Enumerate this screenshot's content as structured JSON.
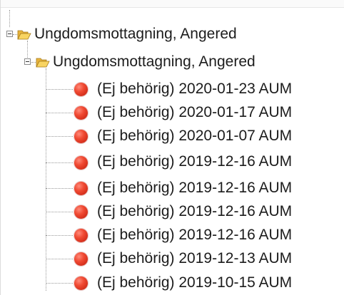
{
  "tree": {
    "root": {
      "label": "Ungdomsmottagning, Angered",
      "icon": "folder-open-icon",
      "expanded": true
    },
    "child": {
      "label": "Ungdomsmottagning, Angered",
      "icon": "folder-open-icon",
      "expanded": true
    },
    "items": [
      {
        "label": "(Ej behörig) 2020-01-23 AUM",
        "icon": "red-status-icon"
      },
      {
        "label": "(Ej behörig) 2020-01-17 AUM",
        "icon": "red-status-icon"
      },
      {
        "label": "(Ej behörig) 2020-01-07 AUM",
        "icon": "red-status-icon"
      },
      {
        "label": "(Ej behörig) 2019-12-16 AUM",
        "icon": "red-status-icon"
      },
      {
        "label": "(Ej behörig) 2019-12-16 AUM",
        "icon": "red-status-icon"
      },
      {
        "label": "(Ej behörig) 2019-12-16 AUM",
        "icon": "red-status-icon"
      },
      {
        "label": "(Ej behörig) 2019-12-16 AUM",
        "icon": "red-status-icon"
      },
      {
        "label": "(Ej behörig) 2019-12-13 AUM",
        "icon": "red-status-icon"
      },
      {
        "label": "(Ej behörig) 2019-10-15 AUM",
        "icon": "red-status-icon"
      }
    ]
  },
  "colors": {
    "status_red": "#e2432d",
    "folder_yellow": "#f5c84a",
    "text": "#1c1c1c",
    "connector": "#9a9a9a"
  }
}
